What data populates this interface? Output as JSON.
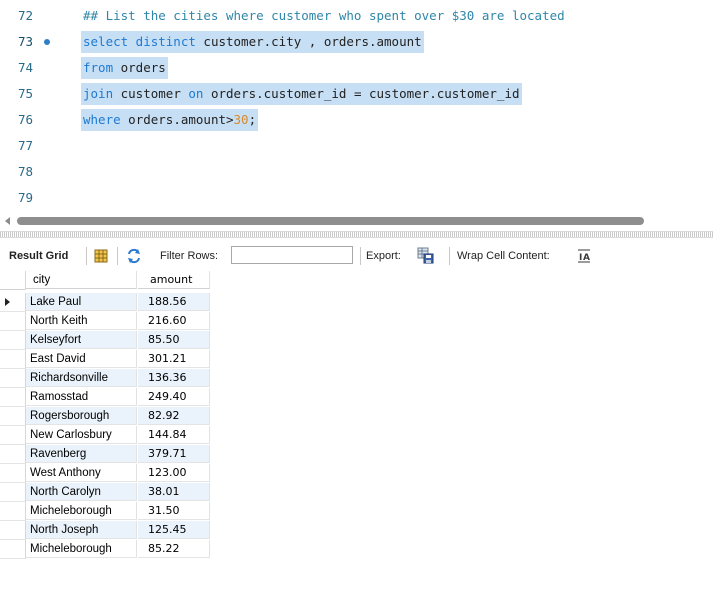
{
  "editor": {
    "lines": [
      {
        "num": "72",
        "text": "## List the cities where customer who spent over $30 are located"
      },
      {
        "num": "73",
        "k1": "select distinct",
        "t1": " customer.city , orders.amount"
      },
      {
        "num": "74",
        "k1": "from",
        "t1": " orders"
      },
      {
        "num": "75",
        "k1": "join",
        "t1": " customer ",
        "k2": "on",
        "t2": " orders.customer_id = customer.customer_id"
      },
      {
        "num": "76",
        "k1": "where",
        "t1": " orders.amount>",
        "n1": "30",
        "t2": ";"
      },
      {
        "num": "77"
      },
      {
        "num": "78"
      },
      {
        "num": "79"
      }
    ]
  },
  "toolbar": {
    "result_grid_label": "Result Grid",
    "filter_rows_label": "Filter Rows:",
    "filter_value": "",
    "export_label": "Export:",
    "wrap_label": "Wrap Cell Content:",
    "icons": [
      "form-editor-icon",
      "refresh-icon",
      "export-icon",
      "wrap-icon"
    ]
  },
  "grid": {
    "columns": [
      "city",
      "amount"
    ],
    "rows": [
      {
        "city": "Lake Paul",
        "amount": "188.56"
      },
      {
        "city": "North Keith",
        "amount": "216.60"
      },
      {
        "city": "Kelseyfort",
        "amount": "85.50"
      },
      {
        "city": "East David",
        "amount": "301.21"
      },
      {
        "city": "Richardsonville",
        "amount": "136.36"
      },
      {
        "city": "Ramosstad",
        "amount": "249.40"
      },
      {
        "city": "Rogersborough",
        "amount": "82.92"
      },
      {
        "city": "New Carlosbury",
        "amount": "144.84"
      },
      {
        "city": "Ravenberg",
        "amount": "379.71"
      },
      {
        "city": "West Anthony",
        "amount": "123.00"
      },
      {
        "city": "North Carolyn",
        "amount": "38.01"
      },
      {
        "city": "Micheleborough",
        "amount": "31.50"
      },
      {
        "city": "North Joseph",
        "amount": "125.45"
      },
      {
        "city": "Micheleborough",
        "amount": "85.22"
      }
    ]
  },
  "colors": {
    "keyword": "#1e7ad1",
    "comment": "#2f86a9",
    "number": "#d78a2e",
    "selection": "#c7dff5",
    "row_alt": "#eaf3fb"
  }
}
